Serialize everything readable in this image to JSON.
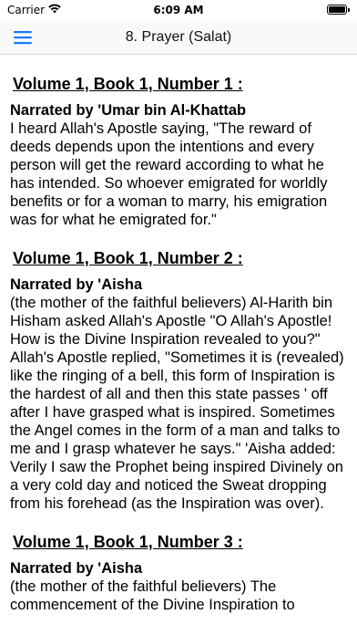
{
  "status_bar": {
    "carrier": "Carrier",
    "time": "6:09 AM",
    "battery_level": 1.0
  },
  "nav": {
    "menu_icon": "hamburger-menu-icon",
    "title": "8. Prayer (Salat)",
    "accent_color": "#1a7cf5"
  },
  "hadiths": [
    {
      "heading": "Volume 1, Book 1, Number 1 :",
      "narrator": "Narrated by 'Umar bin Al-Khattab",
      "text": "I heard Allah's Apostle saying, \"The reward of deeds depends upon the intentions and every person will get the reward according to what he has intended. So whoever emigrated for worldly benefits or for a woman to marry, his emigration was for what he emigrated for.\""
    },
    {
      "heading": "Volume 1, Book 1, Number 2 :",
      "narrator": "Narrated by 'Aisha",
      "text": "(the mother of the faithful believers) Al-Harith bin Hisham asked Allah's Apostle \"O Allah's Apostle! How is the Divine Inspiration revealed to you?\" Allah's Apostle replied, \"Sometimes it is (revealed) like the ringing of a bell, this form of Inspiration is the hardest of all and then this state passes ' off after I have grasped what is inspired. Sometimes the Angel comes in the form of a man and talks to me and I grasp whatever he says.\" 'Aisha added: Verily I saw the Prophet being inspired Divinely on a very cold day and noticed the Sweat dropping from his forehead (as the Inspiration was over)."
    },
    {
      "heading": "Volume 1, Book 1, Number 3 :",
      "narrator": "Narrated by 'Aisha",
      "text": "(the mother of the faithful believers) The commencement of the Divine Inspiration to"
    }
  ]
}
